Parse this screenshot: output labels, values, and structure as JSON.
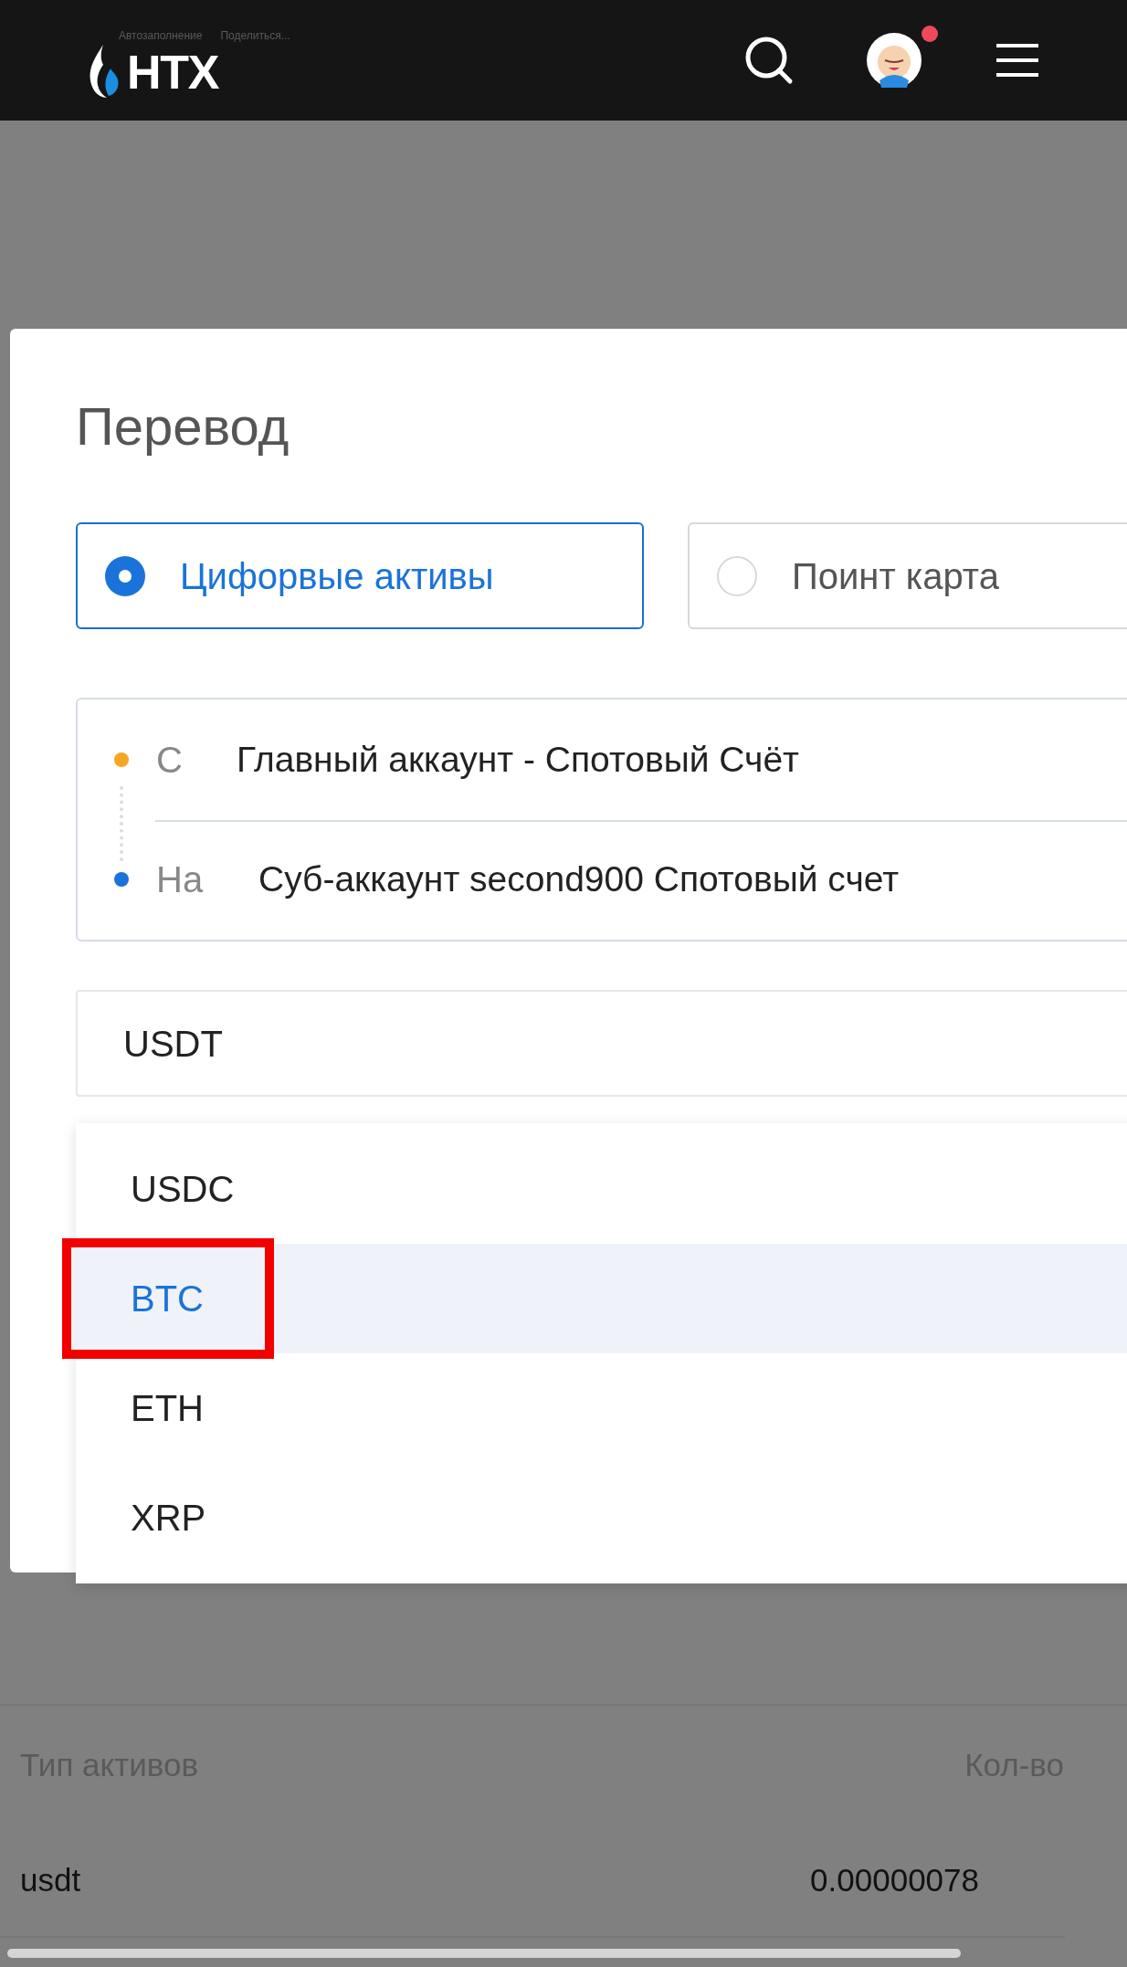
{
  "header": {
    "logo": "HTX",
    "hints": [
      "Автозаполнение",
      "Поделиться..."
    ],
    "notification": true
  },
  "dialog": {
    "title": "Перевод",
    "options": [
      {
        "label": "Цифорвые активы",
        "selected": true
      },
      {
        "label": "Поинт карта",
        "selected": false
      }
    ],
    "route": [
      {
        "label": "С",
        "account": "Главный аккаунт - Спотовый Счёт",
        "color": "#f5a623"
      },
      {
        "label": "На",
        "account": "Суб-аккаунт second900 Спотовый счет",
        "color": "#1a73d9"
      }
    ],
    "coin": {
      "value": "USDT"
    },
    "dropdown": [
      {
        "label": "USDC",
        "selected": false,
        "marked": false
      },
      {
        "label": "BTC",
        "selected": true,
        "marked": true
      },
      {
        "label": "ETH",
        "selected": false,
        "marked": false
      },
      {
        "label": "XRP",
        "selected": false,
        "marked": false
      }
    ]
  },
  "table": {
    "columns": [
      "Тип активов",
      "Кол-во"
    ],
    "rows": [
      [
        "usdt",
        "0.00000078"
      ]
    ]
  }
}
